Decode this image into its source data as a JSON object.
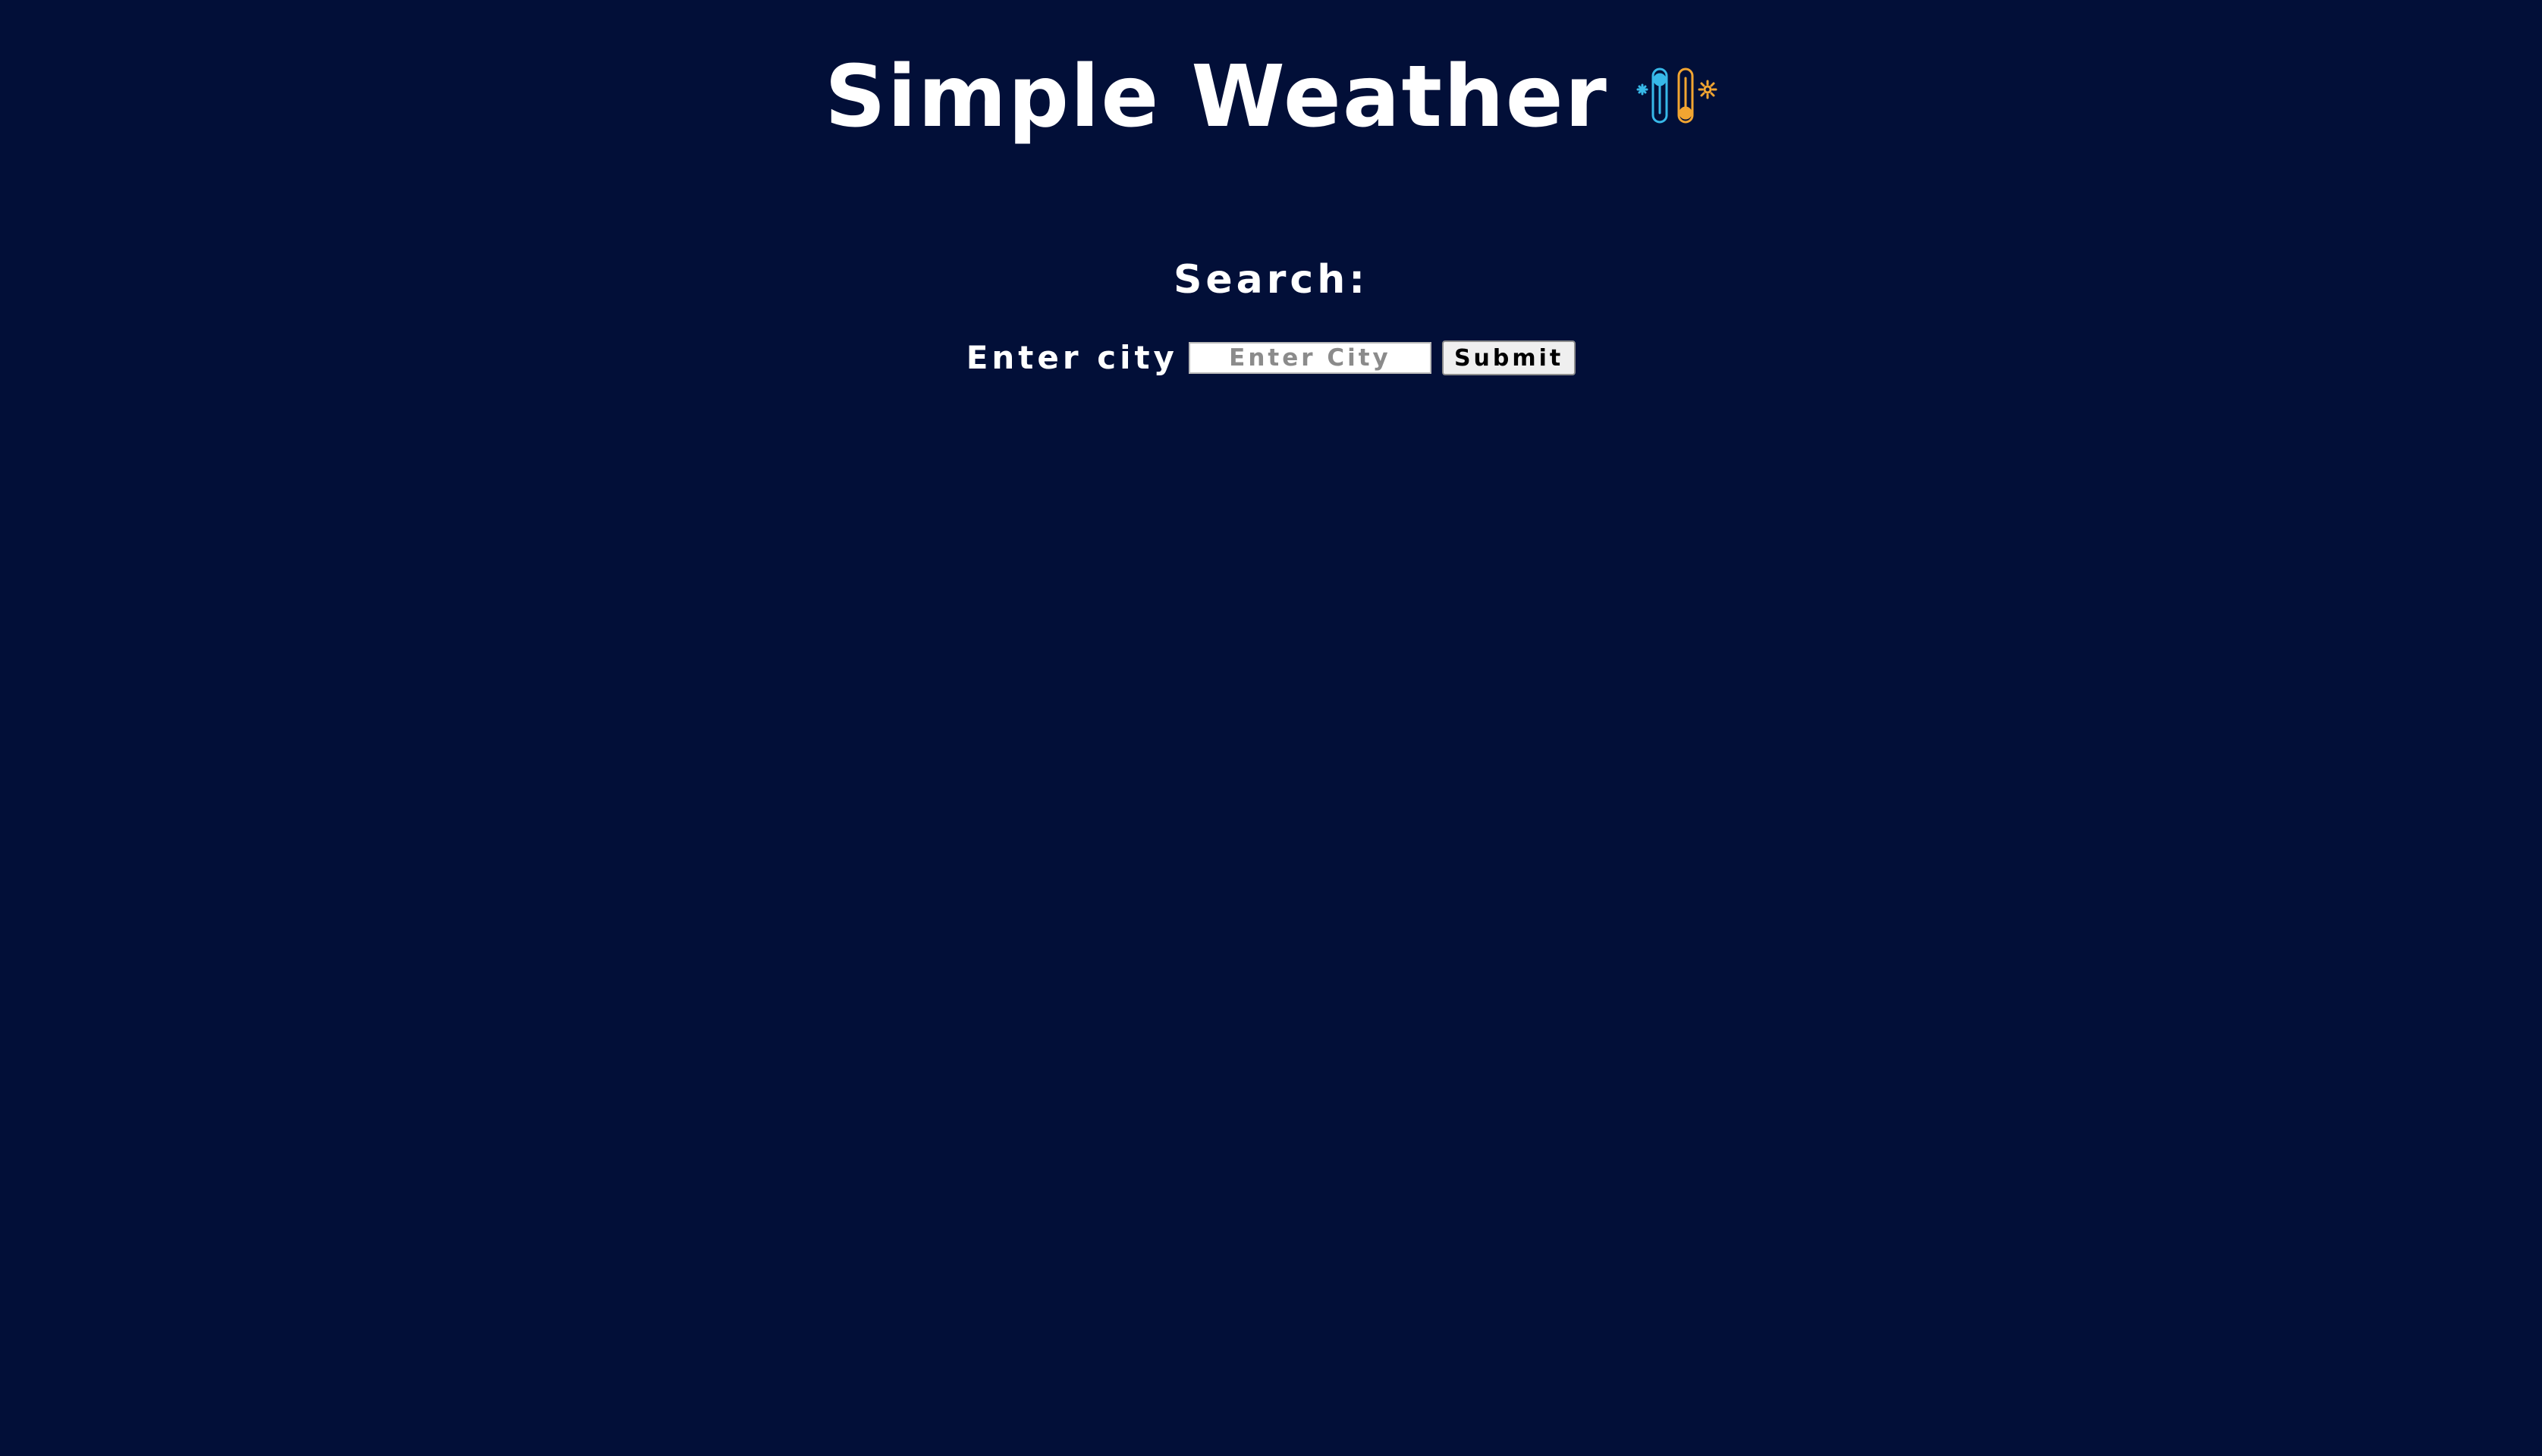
{
  "header": {
    "title": "Simple Weather",
    "logo_icon": "thermometer-hot-cold-icon"
  },
  "search": {
    "heading": "Search:",
    "label": "Enter city",
    "input_value": "",
    "placeholder": "Enter City",
    "submit_label": "Submit"
  },
  "colors": {
    "background": "#020f38",
    "text": "#ffffff",
    "cold_accent": "#37b8e8",
    "hot_accent": "#f2a531"
  }
}
